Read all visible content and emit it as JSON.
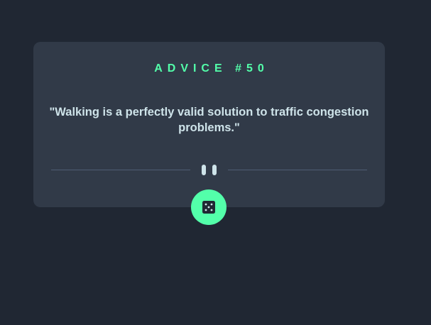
{
  "card": {
    "heading": "ADVICE #50",
    "quote": "\"Walking is a perfectly valid solution to traffic congestion problems.\""
  },
  "icons": {
    "divider": "pause-icon",
    "button": "dice-icon"
  },
  "colors": {
    "background": "#202733",
    "card": "#313a48",
    "accent": "#53ffaa",
    "text": "#cee3e9",
    "divider": "#4f5d74"
  }
}
